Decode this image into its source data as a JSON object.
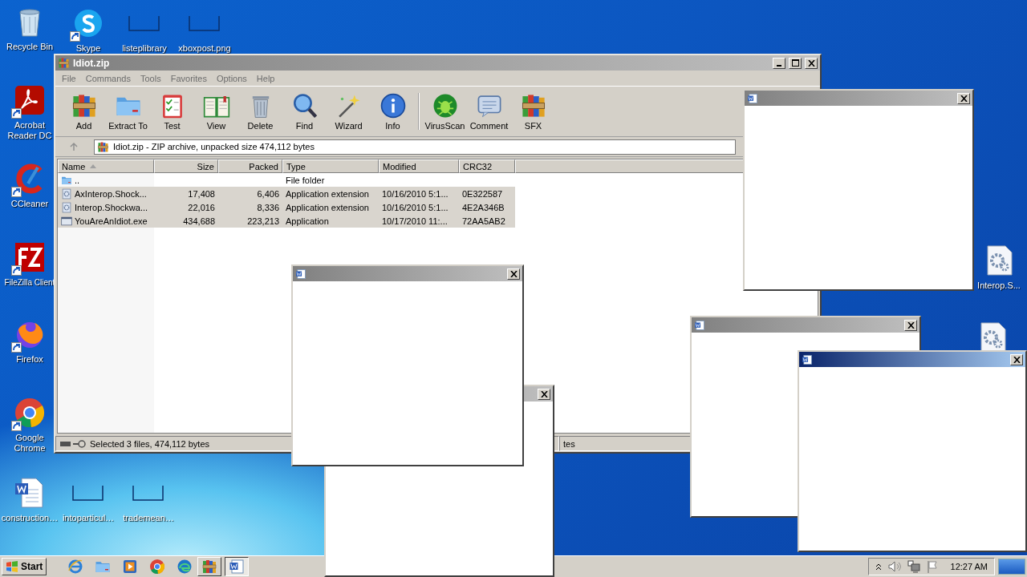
{
  "desktop_icons": [
    {
      "label": "Recycle Bin",
      "kind": "recycle-bin",
      "shortcut": false
    },
    {
      "label": "Skype",
      "kind": "skype",
      "shortcut": true
    },
    {
      "label": "listeplibrary",
      "kind": "thumbnail",
      "shortcut": false
    },
    {
      "label": "xboxpost.png",
      "kind": "thumbnail",
      "shortcut": false
    },
    {
      "label": "Acrobat Reader DC",
      "kind": "acrobat",
      "shortcut": true
    },
    {
      "label": "CCleaner",
      "kind": "ccleaner",
      "shortcut": true
    },
    {
      "label": "FileZilla Client",
      "kind": "filezilla",
      "shortcut": true
    },
    {
      "label": "Firefox",
      "kind": "firefox",
      "shortcut": true
    },
    {
      "label": "Google Chrome",
      "kind": "chrome",
      "shortcut": true
    },
    {
      "label": "construction…",
      "kind": "word-doc",
      "shortcut": false
    },
    {
      "label": "intoparticul…",
      "kind": "thumbnail",
      "shortcut": false
    },
    {
      "label": "trademean…",
      "kind": "thumbnail",
      "shortcut": false
    },
    {
      "label": "Interop.S...",
      "kind": "gear-doc",
      "shortcut": false
    },
    {
      "kind": "gear-doc",
      "shortcut": false
    }
  ],
  "archive_window": {
    "title": "Idiot.zip",
    "active": false,
    "menu": [
      "File",
      "Commands",
      "Tools",
      "Favorites",
      "Options",
      "Help"
    ],
    "toolbar": [
      {
        "buttons": [
          {
            "label": "Add",
            "kind": "add"
          },
          {
            "label": "Extract To",
            "kind": "extract"
          },
          {
            "label": "Test",
            "kind": "test"
          },
          {
            "label": "View",
            "kind": "view"
          },
          {
            "label": "Delete",
            "kind": "delete"
          },
          {
            "label": "Find",
            "kind": "find"
          },
          {
            "label": "Wizard",
            "kind": "wizard"
          },
          {
            "label": "Info",
            "kind": "info"
          }
        ]
      },
      {
        "buttons": [
          {
            "label": "VirusScan",
            "kind": "virus"
          },
          {
            "label": "Comment",
            "kind": "comment"
          },
          {
            "label": "SFX",
            "kind": "sfx"
          }
        ]
      }
    ],
    "address": "Idiot.zip - ZIP archive, unpacked size 474,112 bytes",
    "columns": [
      {
        "label": "Name",
        "sorted": true
      },
      {
        "label": "Size",
        "sorted": false
      },
      {
        "label": "Packed",
        "sorted": false
      },
      {
        "label": "Type",
        "sorted": false
      },
      {
        "label": "Modified",
        "sorted": false
      },
      {
        "label": "CRC32",
        "sorted": false
      }
    ],
    "rows": [
      {
        "kind": "folder",
        "selected": false,
        "cells": [
          "..",
          null,
          null,
          "File folder",
          null,
          null
        ]
      },
      {
        "kind": "dll",
        "selected": true,
        "cells": [
          "AxInterop.Shock...",
          "17,408",
          "6,406",
          "Application extension",
          "10/16/2010 5:1...",
          "0E322587"
        ]
      },
      {
        "kind": "dll",
        "selected": true,
        "cells": [
          "Interop.Shockwa...",
          "22,016",
          "8,336",
          "Application extension",
          "10/16/2010 5:1...",
          "4E2A346B"
        ]
      },
      {
        "kind": "exe",
        "selected": true,
        "cells": [
          "YouAreAnIdiot.exe",
          "434,688",
          "223,213",
          "Application",
          "10/17/2010 11:...",
          "72AA5AB2"
        ]
      }
    ],
    "status_left": "Selected 3 files, 474,112 bytes",
    "status_right": "tes"
  },
  "popups": [
    {
      "active": false,
      "icon": true
    },
    {
      "active": false
    },
    {
      "active": false,
      "icon": true
    },
    {
      "active": false,
      "icon": true
    },
    {
      "active": true,
      "icon": true
    }
  ],
  "taskbar": {
    "start": "Start",
    "quick_launch": [
      {
        "kind": "ie"
      },
      {
        "kind": "folder"
      },
      {
        "kind": "media"
      },
      {
        "kind": "chrome"
      },
      {
        "kind": "edge"
      }
    ],
    "tasks": [
      {
        "kind": "archive",
        "pressed": false
      },
      {
        "kind": "word",
        "pressed": true
      }
    ],
    "clock": "12:27 AM"
  }
}
